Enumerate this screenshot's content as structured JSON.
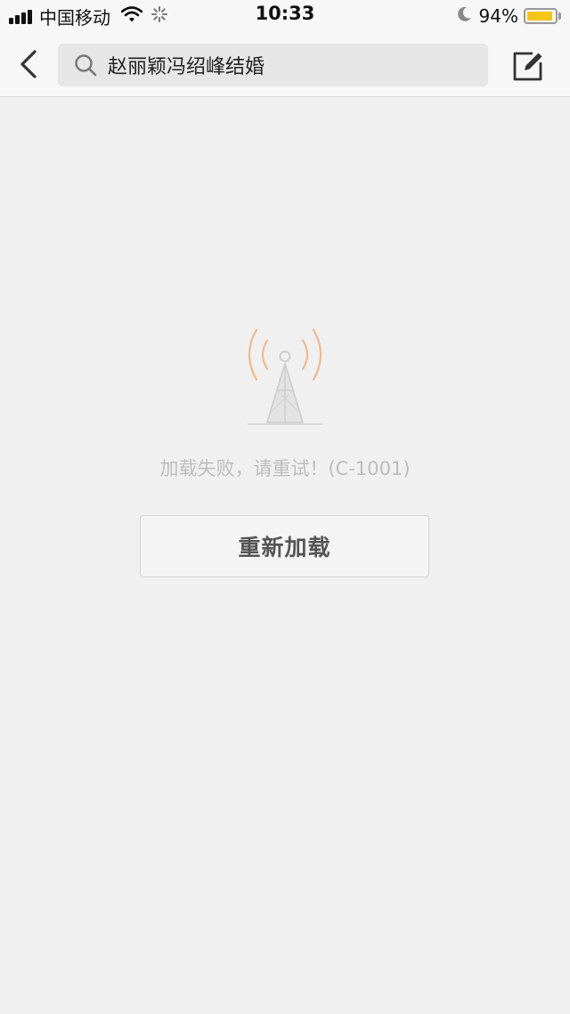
{
  "status_bar": {
    "carrier": "中国移动",
    "time": "10:33",
    "battery_percent": "94%",
    "battery_level": 0.94,
    "icons": [
      "signal-icon",
      "wifi-icon",
      "loading-icon",
      "moon-icon",
      "battery-icon"
    ]
  },
  "nav": {
    "back_icon": "chevron-left-icon",
    "search_icon": "search-icon",
    "search_query": "赵丽颖冯绍峰结婚",
    "compose_icon": "compose-icon"
  },
  "error": {
    "icon": "signal-tower-icon",
    "message": "加载失败，请重试！(C-1001)",
    "reload_label": "重新加载"
  },
  "colors": {
    "background": "#f0f0f0",
    "battery_fill": "#f5c518",
    "tower_waves": "#f3b98a",
    "error_text": "#bdbdbd"
  }
}
